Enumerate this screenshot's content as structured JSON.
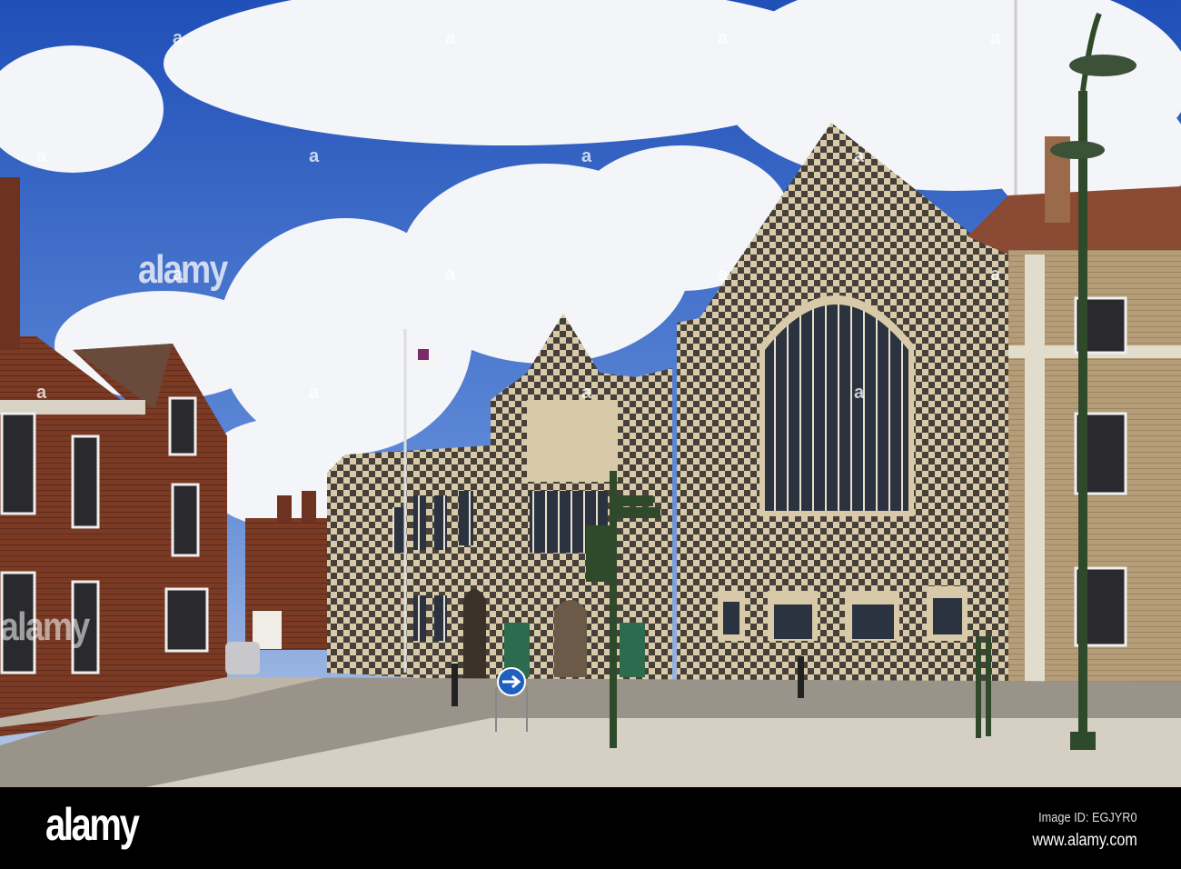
{
  "watermark": {
    "logo": "alamy",
    "mark_letter": "a"
  },
  "footer": {
    "logo": "alamy",
    "image_id": "Image ID: EGJYR0",
    "website": "www.alamy.com"
  },
  "colors": {
    "sky": "#2f5fc4",
    "brick": "#7a3a24",
    "stone": "#c9b48a",
    "flint": "#3a3530",
    "lamp": "#2f4a2a",
    "footer_bg": "#000000"
  }
}
